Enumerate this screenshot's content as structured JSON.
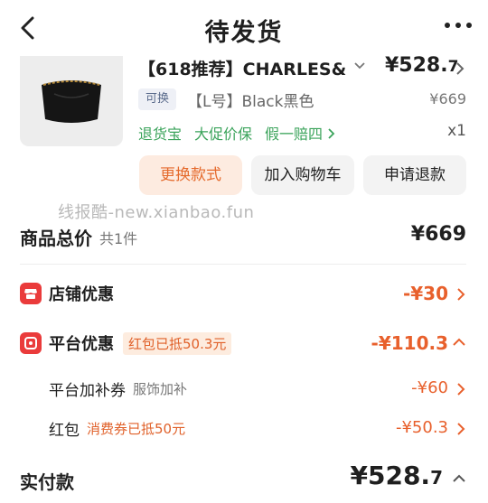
{
  "header": {
    "title": "待发货"
  },
  "product": {
    "name": "【618推荐】CHARLES&",
    "price_main": "¥528.",
    "price_decimal": "7",
    "replace_tag": "可换",
    "spec": "【L号】Black黑色",
    "original_price": "¥669",
    "services": [
      "退货宝",
      "大促价保",
      "假一赔四"
    ],
    "quantity": "x1"
  },
  "actions": {
    "swap_label": "更换款式",
    "cart_label": "加入购物车",
    "refund_label": "申请退款"
  },
  "watermark": "线报酷-new.xianbao.fun",
  "summary": {
    "total_label": "商品总价",
    "total_count": "共1件",
    "total_value": "¥669",
    "store_discount_label": "店铺优惠",
    "store_discount_value": "-¥30",
    "platform_discount_label": "平台优惠",
    "platform_discount_tag": "红包已抵50.3元",
    "platform_discount_value": "-¥110.3",
    "subsidy_label": "平台加补券",
    "subsidy_note": "服饰加补",
    "subsidy_value": "-¥60",
    "redpack_label": "红包",
    "redpack_note": "消费券已抵50元",
    "redpack_value": "-¥50.3",
    "paid_label": "实付款",
    "paid_main": "¥528.",
    "paid_decimal": "7"
  },
  "colors": {
    "accent_orange": "#e8602c",
    "accent_green": "#3aa35a",
    "icon_red": "#ea3b3b"
  },
  "icons": [
    "back-arrow-icon",
    "more-dots-icon",
    "chevron-down-icon",
    "chevron-right-icon",
    "chevron-up-icon",
    "store-icon",
    "platform-icon"
  ]
}
